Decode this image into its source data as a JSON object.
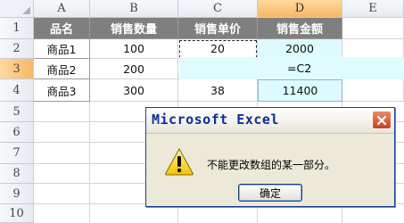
{
  "columns": [
    "A",
    "B",
    "C",
    "D",
    "E"
  ],
  "rows": [
    "1",
    "2",
    "3",
    "4",
    "5",
    "6",
    "7",
    "8",
    "9",
    "10"
  ],
  "header_row": [
    "品名",
    "销售数量",
    "销售单价",
    "销售金额"
  ],
  "data_rows": [
    {
      "name": "商品1",
      "qty": "100",
      "price": "20",
      "amount": "2000"
    },
    {
      "name": "商品2",
      "qty": "200",
      "price": "",
      "amount": ""
    },
    {
      "name": "商品3",
      "qty": "300",
      "price": "38",
      "amount": "11400"
    }
  ],
  "edit_formula": "=C2",
  "dialog": {
    "title": "Microsoft Excel",
    "message": "不能更改数组的某一部分。",
    "ok_label": "确定",
    "icon": "warning-icon",
    "close_icon": "close-icon"
  },
  "colors": {
    "header_fill": "#7f7f7f",
    "highlight": "#ddfafe",
    "selected_header": "#f7b863",
    "dialog_bg": "#ece9d8",
    "title_text": "#0c2e9a"
  }
}
